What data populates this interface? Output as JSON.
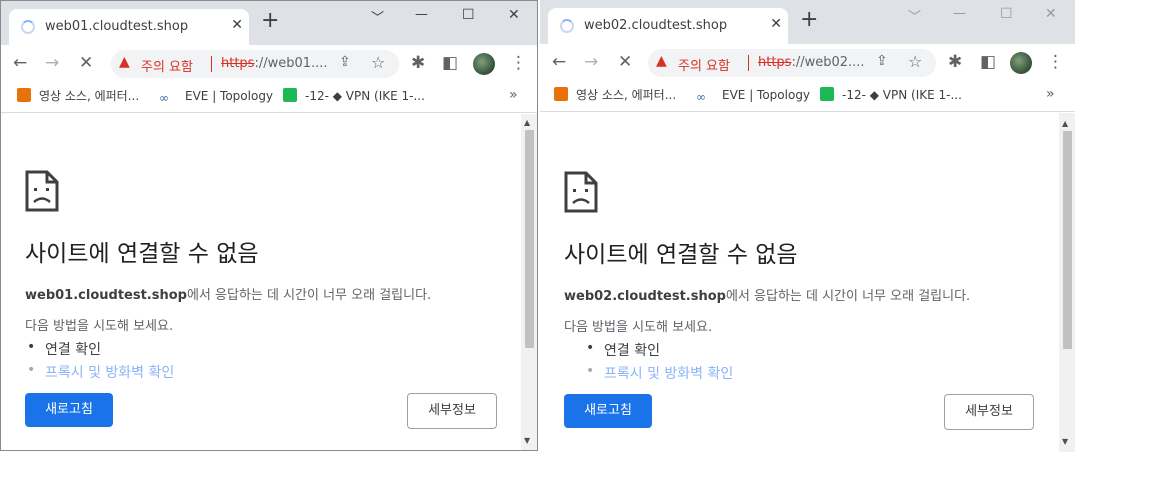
{
  "windows": [
    {
      "tab_title": "web01.cloudtest.shop",
      "warning_text": "주의 요함",
      "url_scheme": "https",
      "url_rest": "://web01....",
      "bookmarks": [
        "영상 소스, 에퍼터...",
        "EVE | Topology",
        "-12- ◆ VPN (IKE 1-..."
      ],
      "error_title": "사이트에 연결할 수 없음",
      "error_host": "web01.cloudtest.shop",
      "error_suffix": "에서 응답하는 데 시간이 너무 오래 걸립니다.",
      "try_text": "다음 방법을 시도해 보세요.",
      "suggestion_1": "연결 확인",
      "suggestion_2": "프록시 및 방화벽 확인",
      "reload_label": "새로고침",
      "details_label": "세부정보"
    },
    {
      "tab_title": "web02.cloudtest.shop",
      "warning_text": "주의 요함",
      "url_scheme": "https",
      "url_rest": "://web02....",
      "bookmarks": [
        "영상 소스, 에퍼터...",
        "EVE | Topology",
        "-12- ◆ VPN (IKE 1-..."
      ],
      "error_title": "사이트에 연결할 수 없음",
      "error_host": "web02.cloudtest.shop",
      "error_suffix": "에서 응답하는 데 시간이 너무 오래 걸립니다.",
      "try_text": "다음 방법을 시도해 보세요.",
      "suggestion_1": "연결 확인",
      "suggestion_2": "프록시 및 방화벽 확인",
      "reload_label": "새로고침",
      "details_label": "세부정보"
    }
  ],
  "icons": {
    "tab_close": "✕",
    "new_tab": "+",
    "minimize": "﹀",
    "restore": "—",
    "maximize": "☐",
    "close": "✕",
    "back": "←",
    "forward": "→",
    "stop": "✕",
    "warning": "▲",
    "share": "⇪",
    "star": "☆",
    "extensions": "✱",
    "sidepanel": "◧",
    "menu": "⋮",
    "bookmarks_more": "»",
    "eve": "∞",
    "scroll_up": "▲",
    "scroll_down": "▼"
  },
  "colors": {
    "reload_button": "#1a73e8",
    "warning": "#d93025",
    "link": "#8ab4f8"
  }
}
